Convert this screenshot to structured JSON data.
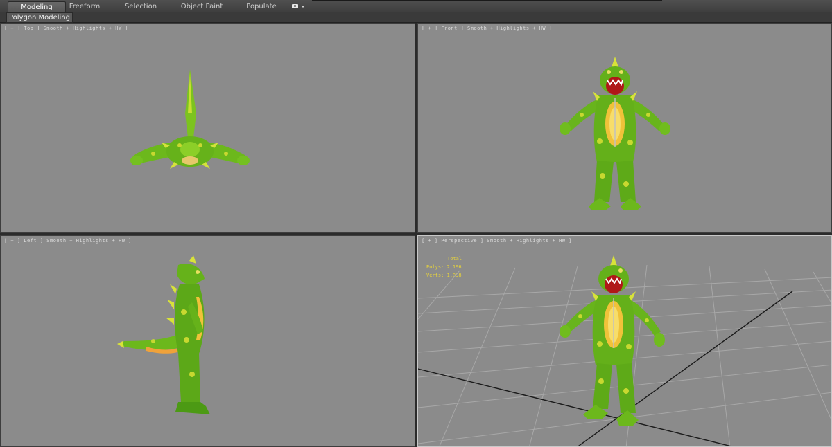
{
  "ribbon": {
    "tabs": [
      {
        "label": "Modeling",
        "active": true
      },
      {
        "label": "Freeform",
        "active": false
      },
      {
        "label": "Selection",
        "active": false
      },
      {
        "label": "Object Paint",
        "active": false
      },
      {
        "label": "Populate",
        "active": false
      }
    ],
    "panel_label": "Polygon Modeling"
  },
  "viewports": {
    "top": {
      "label": "[ + ] Top ] Smooth + Highlights + HW ]"
    },
    "front": {
      "label": "[ + ] Front ] Smooth + Highlights + HW ]"
    },
    "left": {
      "label": "[ + ] Left ] Smooth + Highlights + HW ]"
    },
    "perspective": {
      "label": "[ + ] Perspective ] Smooth + Highlights + HW ]"
    }
  },
  "stats": {
    "header": "Total",
    "polys": "Polys: 2,196",
    "verts": "Verts: 1,098"
  },
  "colors": {
    "viewport_bg": "#8b8b8b",
    "skin_green": "#6fbf1e",
    "spot_yellow": "#c8d830",
    "belly_yellow": "#f0c23a",
    "mouth_red": "#b01818",
    "stats_text": "#e8d43a"
  }
}
